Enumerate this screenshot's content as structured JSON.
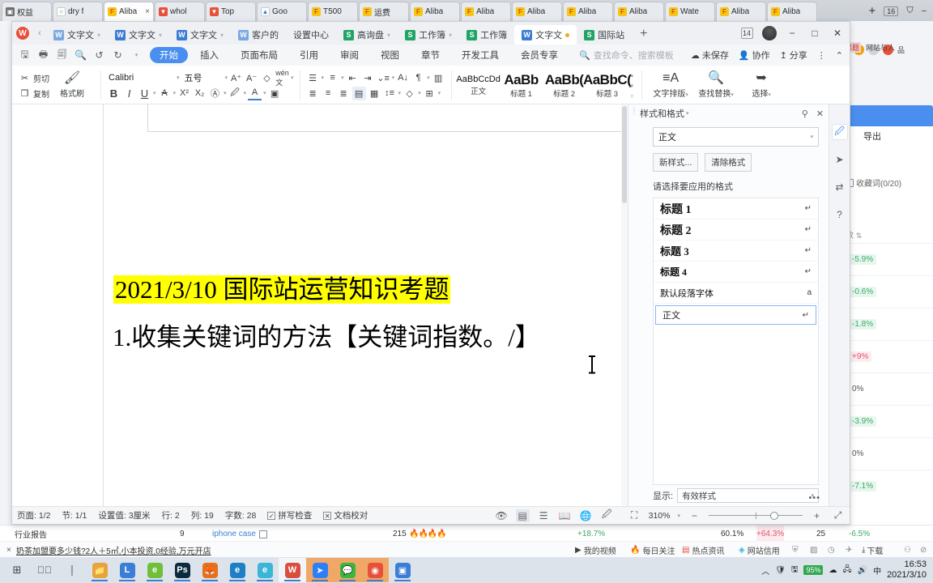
{
  "browser": {
    "tabs": [
      {
        "label": "权益",
        "fav": "grey",
        "active": false
      },
      {
        "label": "dry f",
        "fav": "green",
        "active": false
      },
      {
        "label": "Aliba",
        "fav": "yellow",
        "active": true
      },
      {
        "label": "whol",
        "fav": "red",
        "active": false
      },
      {
        "label": "Top",
        "fav": "red",
        "active": false
      },
      {
        "label": "Goo",
        "fav": "blue",
        "active": false
      },
      {
        "label": "T500",
        "fav": "yellow",
        "active": false
      },
      {
        "label": "运费",
        "fav": "yellow",
        "active": false
      },
      {
        "label": "Aliba",
        "fav": "yellow",
        "active": false
      },
      {
        "label": "Aliba",
        "fav": "yellow",
        "active": false
      },
      {
        "label": "Aliba",
        "fav": "yellow",
        "active": false
      },
      {
        "label": "Aliba",
        "fav": "yellow",
        "active": false
      },
      {
        "label": "Aliba",
        "fav": "yellow",
        "active": false
      },
      {
        "label": "Wate",
        "fav": "yellow",
        "active": false
      },
      {
        "label": "Aliba",
        "fav": "yellow",
        "active": false
      },
      {
        "label": "Aliba",
        "fav": "yellow",
        "active": false
      }
    ],
    "new_tab": "+",
    "tab_count": "16",
    "tab_list_icon": "tab-list-icon",
    "minimize": "−",
    "close_tab_x": "×"
  },
  "background_panel": {
    "export_label": "导出",
    "collect_label": "收藏词(0/20)",
    "column_header": "数",
    "rows": [
      "-5.9%",
      "-0.6%",
      "-1.8%",
      "+9%",
      "0%",
      "-3.9%",
      "0%",
      "-7.1%"
    ],
    "bookmark1": "品课题",
    "bookmark2": "网站与人"
  },
  "background_table": {
    "row1": {
      "category": "行业报告",
      "count": "9",
      "keyword": "iphone case",
      "num": "215",
      "fire": "🔥🔥🔥🔥",
      "pct1": "+18.7%",
      "pct2": "60.1%",
      "pct3": "+64.3%",
      "num2": "25",
      "pct4": "-6.5%"
    },
    "row2": {
      "ad_text": "奶茶加盟要多少钱?2人＋5㎡,小本投资,0经验,万元开店",
      "links": [
        "我的视频",
        "每日关注",
        "热点资讯",
        "网站信用",
        "下载"
      ]
    }
  },
  "wps": {
    "doc_tabs": [
      {
        "label": "文字文",
        "icon": "wl",
        "active": false,
        "caret": true
      },
      {
        "label": "文字文",
        "icon": "w",
        "active": false,
        "caret": true
      },
      {
        "label": "文字文",
        "icon": "w",
        "active": false,
        "caret": true
      },
      {
        "label": "客户的",
        "icon": "wl",
        "active": false,
        "caret": false
      },
      {
        "label": "设置中心",
        "icon": "none",
        "active": false,
        "caret": false
      },
      {
        "label": "高询盘",
        "icon": "s",
        "active": false,
        "caret": true
      },
      {
        "label": "工作簿",
        "icon": "s",
        "active": false,
        "caret": true
      },
      {
        "label": "工作簿",
        "icon": "s",
        "active": false,
        "caret": false
      },
      {
        "label": "文字文",
        "icon": "w",
        "active": true,
        "caret": false,
        "dirty": true
      },
      {
        "label": "国际站",
        "icon": "s",
        "active": false,
        "caret": false
      }
    ],
    "add_tab": "+",
    "window_controls": {
      "count_badge": "14",
      "minimize": "−",
      "maximize": "□",
      "close": "✕"
    },
    "ribbon_tabs": [
      {
        "label": "开始",
        "active": true
      },
      {
        "label": "插入",
        "active": false
      },
      {
        "label": "页面布局",
        "active": false
      },
      {
        "label": "引用",
        "active": false
      },
      {
        "label": "审阅",
        "active": false
      },
      {
        "label": "视图",
        "active": false
      },
      {
        "label": "章节",
        "active": false
      },
      {
        "label": "开发工具",
        "active": false
      },
      {
        "label": "会员专享",
        "active": false
      }
    ],
    "search_placeholder": "查找命令、搜索模板",
    "header_actions": [
      {
        "label": "未保存",
        "icon": "cloud-icon"
      },
      {
        "label": "协作",
        "icon": "collaborate-icon"
      },
      {
        "label": "分享",
        "icon": "share-icon"
      }
    ],
    "more_menu": "⋮",
    "collapse_ribbon": "⌃",
    "clipboard": {
      "cut": "剪切",
      "copy": "复制",
      "format_painter": "格式刷"
    },
    "font": {
      "name": "Calibri",
      "size": "五号",
      "grow": "A",
      "shrink": "A",
      "clear_format": "清除格式",
      "pinyin": "拼音",
      "bold": "B",
      "italic": "I",
      "underline": "U",
      "strikethrough": "A",
      "superscript": "X²",
      "subscript": "X₂",
      "char_border": "A",
      "highlight": "highlight-icon",
      "font_color": "A",
      "char_shading": "A"
    },
    "paragraph": {
      "bullets": "bullet-list-icon",
      "numbering": "numbered-list-icon",
      "decrease_indent": "decrease-indent-icon",
      "increase_indent": "increase-indent-icon",
      "multilevel": "multilevel-list-icon",
      "sort": "sort-icon",
      "show_marks": "paragraph-marks-icon",
      "ruler": "ruler-icon",
      "align_left": "align-left-icon",
      "align_center": "align-center-icon",
      "align_right": "align-right-icon",
      "justify": "justify-icon",
      "distribute": "distribute-icon",
      "line_spacing": "line-spacing-icon",
      "shading": "shading-icon",
      "borders": "borders-icon"
    },
    "styles_gallery": [
      {
        "preview": "AaBbCcDd",
        "name": "正文",
        "big": false
      },
      {
        "preview": "AaBb",
        "name": "标题 1",
        "big": true
      },
      {
        "preview": "AaBb(",
        "name": "标题 2",
        "big": true
      },
      {
        "preview": "AaBbC(",
        "name": "标题 3",
        "big": true
      }
    ],
    "right_tools": [
      {
        "label": "文字排版",
        "icon": "text-layout-icon"
      },
      {
        "label": "查找替换",
        "icon": "search-icon"
      },
      {
        "label": "选择",
        "icon": "cursor-select-icon"
      }
    ],
    "document": {
      "title": "2021/3/10 国际站运营知识考题",
      "title_highlight_color": "#ffff00",
      "body": "1.收集关键词的方法【关键词指数。/】"
    },
    "styles_pane": {
      "title": "样式和格式",
      "pin_icon": "pin-icon",
      "close_icon": "close-icon",
      "current_style": "正文",
      "new_style_button": "新样式...",
      "clear_format_button": "清除格式",
      "list_label": "请选择要应用的格式",
      "items": [
        {
          "name": "标题 1",
          "mark": "↵",
          "level": "h1"
        },
        {
          "name": "标题 2",
          "mark": "↵",
          "level": "h2"
        },
        {
          "name": "标题 3",
          "mark": "↵",
          "level": "h3"
        },
        {
          "name": "标题 4",
          "mark": "↵",
          "level": "h4"
        },
        {
          "name": "默认段落字体",
          "mark": "a",
          "level": "plain"
        },
        {
          "name": "正文",
          "mark": "↵",
          "level": "selected"
        }
      ],
      "show_label": "显示:",
      "show_value": "有效样式",
      "more_dots": "•••"
    },
    "rail_icons": [
      "pen-icon",
      "cursor-icon",
      "settings-slider-icon",
      "help-icon"
    ],
    "statusbar": {
      "page": "页面: 1/2",
      "section": "节: 1/1",
      "setting": "设置值: 3厘米",
      "row": "行: 2",
      "col": "列: 19",
      "words": "字数: 28",
      "spellcheck": "拼写检查",
      "proofread": "文档校对",
      "view_icons": [
        "eye-icon",
        "page-view-icon",
        "outline-view-icon",
        "read-view-icon",
        "web-view-icon",
        "edit-icon"
      ],
      "fit_icon": "fit-page-icon",
      "zoom": "310%",
      "zoom_out": "−",
      "zoom_in": "+",
      "fullscreen_icon": "fullscreen-icon"
    }
  },
  "taskbar": {
    "start_icon": "start-icon",
    "task_view_icon": "task-view-icon",
    "apps": [
      {
        "name": "file-explorer-icon",
        "color": "#e8a33d",
        "glyph": "📁"
      },
      {
        "name": "app-blue-circle-icon",
        "color": "#3a7fd5",
        "glyph": "L"
      },
      {
        "name": "internet-explorer-icon",
        "color": "#6fbf3b",
        "glyph": "e"
      },
      {
        "name": "photoshop-icon",
        "color": "#0b2a3d",
        "glyph": "Ps"
      },
      {
        "name": "firefox-icon",
        "color": "#e8701a",
        "glyph": "🦊"
      },
      {
        "name": "edge-icon",
        "color": "#1f7fc4",
        "glyph": "e"
      },
      {
        "name": "edge-legacy-icon",
        "color": "#3bb6d6",
        "glyph": "e"
      },
      {
        "name": "wps-icon",
        "color": "#d94f3d",
        "glyph": "W"
      },
      {
        "name": "cursor-app-icon",
        "color": "#2d7ff9",
        "glyph": "➤"
      },
      {
        "name": "wechat-icon",
        "color": "#3ab83a",
        "glyph": "💬"
      },
      {
        "name": "alipay-icon",
        "color": "#e8503a",
        "glyph": "◉"
      },
      {
        "name": "screenshot-icon",
        "color": "#3a7fd5",
        "glyph": "▣"
      }
    ],
    "tray": {
      "up_arrow": "︿",
      "battery": "95%",
      "ime": "中",
      "time": "16:53",
      "date": "2021/3/10"
    }
  }
}
